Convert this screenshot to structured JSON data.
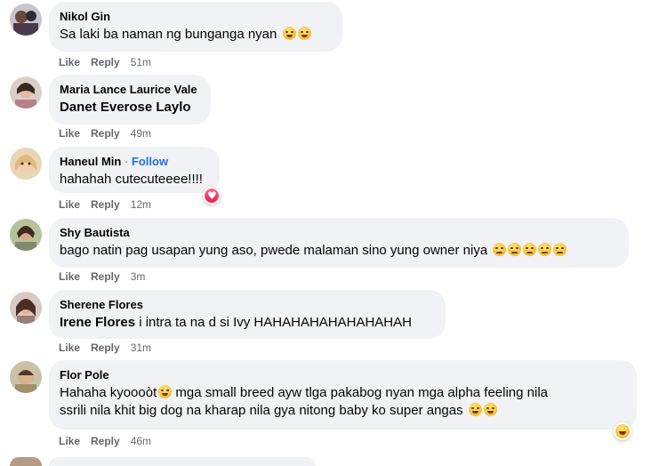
{
  "comments": [
    {
      "name": "Nikol Gin",
      "text": "Sa laki ba naman ng bunganga nyan",
      "emojis": [
        "grin",
        "grin"
      ],
      "like": "Like",
      "reply": "Reply",
      "time": "51m"
    },
    {
      "name": "Maria Lance Laurice Vale",
      "mention": "Danet Everose Laylo",
      "text": "",
      "like": "Like",
      "reply": "Reply",
      "time": "49m"
    },
    {
      "name": "Haneul Min",
      "follow": "Follow",
      "text": "hahahah cutecuteeee!!!!",
      "like": "Like",
      "reply": "Reply",
      "time": "12m",
      "reaction": "heart-icon"
    },
    {
      "name": "Shy Bautista",
      "text": "bago natin pag usapan yung aso, pwede malaman sino yung owner niya",
      "emojis": [
        "sad",
        "sad",
        "sad",
        "sad",
        "sad"
      ],
      "like": "Like",
      "reply": "Reply",
      "time": "3m"
    },
    {
      "name": "Sherene Flores",
      "mention": "Irene Flores",
      "text": " i intra ta na d si Ivy HAHAHAHAHAHAHAHAH",
      "like": "Like",
      "reply": "Reply",
      "time": "31m"
    },
    {
      "name": "Flor Pole",
      "text_line1a": "Hahaha kyoooòt",
      "text_line1b": " mga small breed ayw tlga pakabog nyan mga alpha feeling nila",
      "text_line2": "ssrili nila khit big dog na kharap nila gya nitong baby ko super angas",
      "like": "Like",
      "reply": "Reply",
      "time": "46m",
      "reaction": "haha-icon"
    }
  ],
  "colors": {
    "bubble": "#f0f2f5",
    "meta": "#65676b",
    "follow": "#216fdb"
  }
}
